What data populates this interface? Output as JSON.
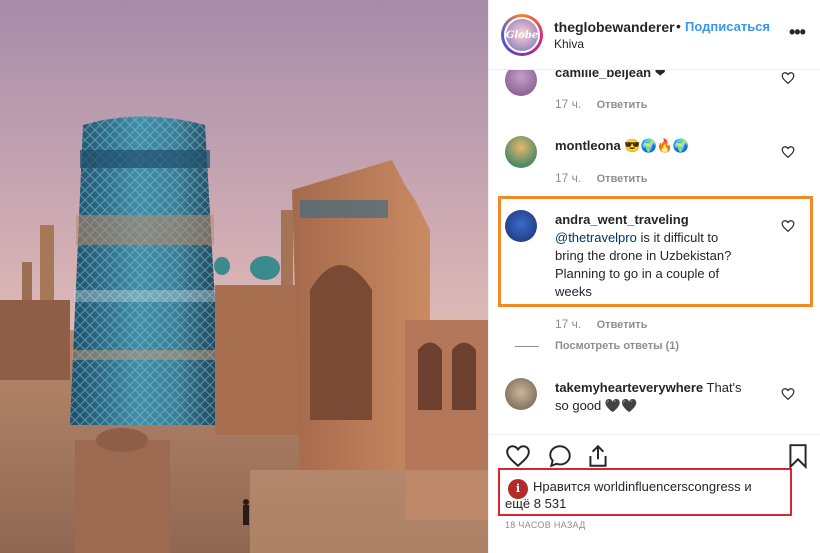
{
  "post": {
    "username": "theglobewanderer",
    "dot": "•",
    "follow_label": "Подписаться",
    "location": "Khiva",
    "avatar_text": "Globe",
    "more_icon": "more-horizontal-icon"
  },
  "comments": [
    {
      "username": "camille_beljean",
      "text": "❤",
      "age": "17 ч.",
      "reply_label": "Ответить"
    },
    {
      "username": "montleona",
      "text": "😎🌍🔥🌍",
      "age": "17 ч.",
      "reply_label": "Ответить"
    },
    {
      "username": "andra_went_traveling",
      "mention": "@thetravelpro",
      "text_line1": "is it difficult to",
      "text_line2": "bring the drone in Uzbekistan?",
      "text_line3": "Planning to go in a couple of",
      "text_line4": "weeks",
      "age": "17 ч.",
      "reply_label": "Ответить",
      "view_replies": "Посмотреть ответы (1)"
    },
    {
      "username": "takemyhearteverywhere",
      "text_line1": "That's",
      "text_line2": "so good 🖤🖤"
    }
  ],
  "actions": {
    "like_icon": "heart-icon",
    "comment_icon": "comment-icon",
    "share_icon": "share-icon",
    "save_icon": "bookmark-icon"
  },
  "likes": {
    "prefix": "Нравится",
    "liker": "worldinfluencerscongress",
    "conj": "и",
    "line2": "ещё 8 531",
    "avatar_text": "i"
  },
  "timestamp": "18 ЧАСОВ НАЗАД",
  "colors": {
    "link": "#3897f0",
    "highlight_orange": "#f08a24",
    "highlight_red": "#d9262c"
  }
}
